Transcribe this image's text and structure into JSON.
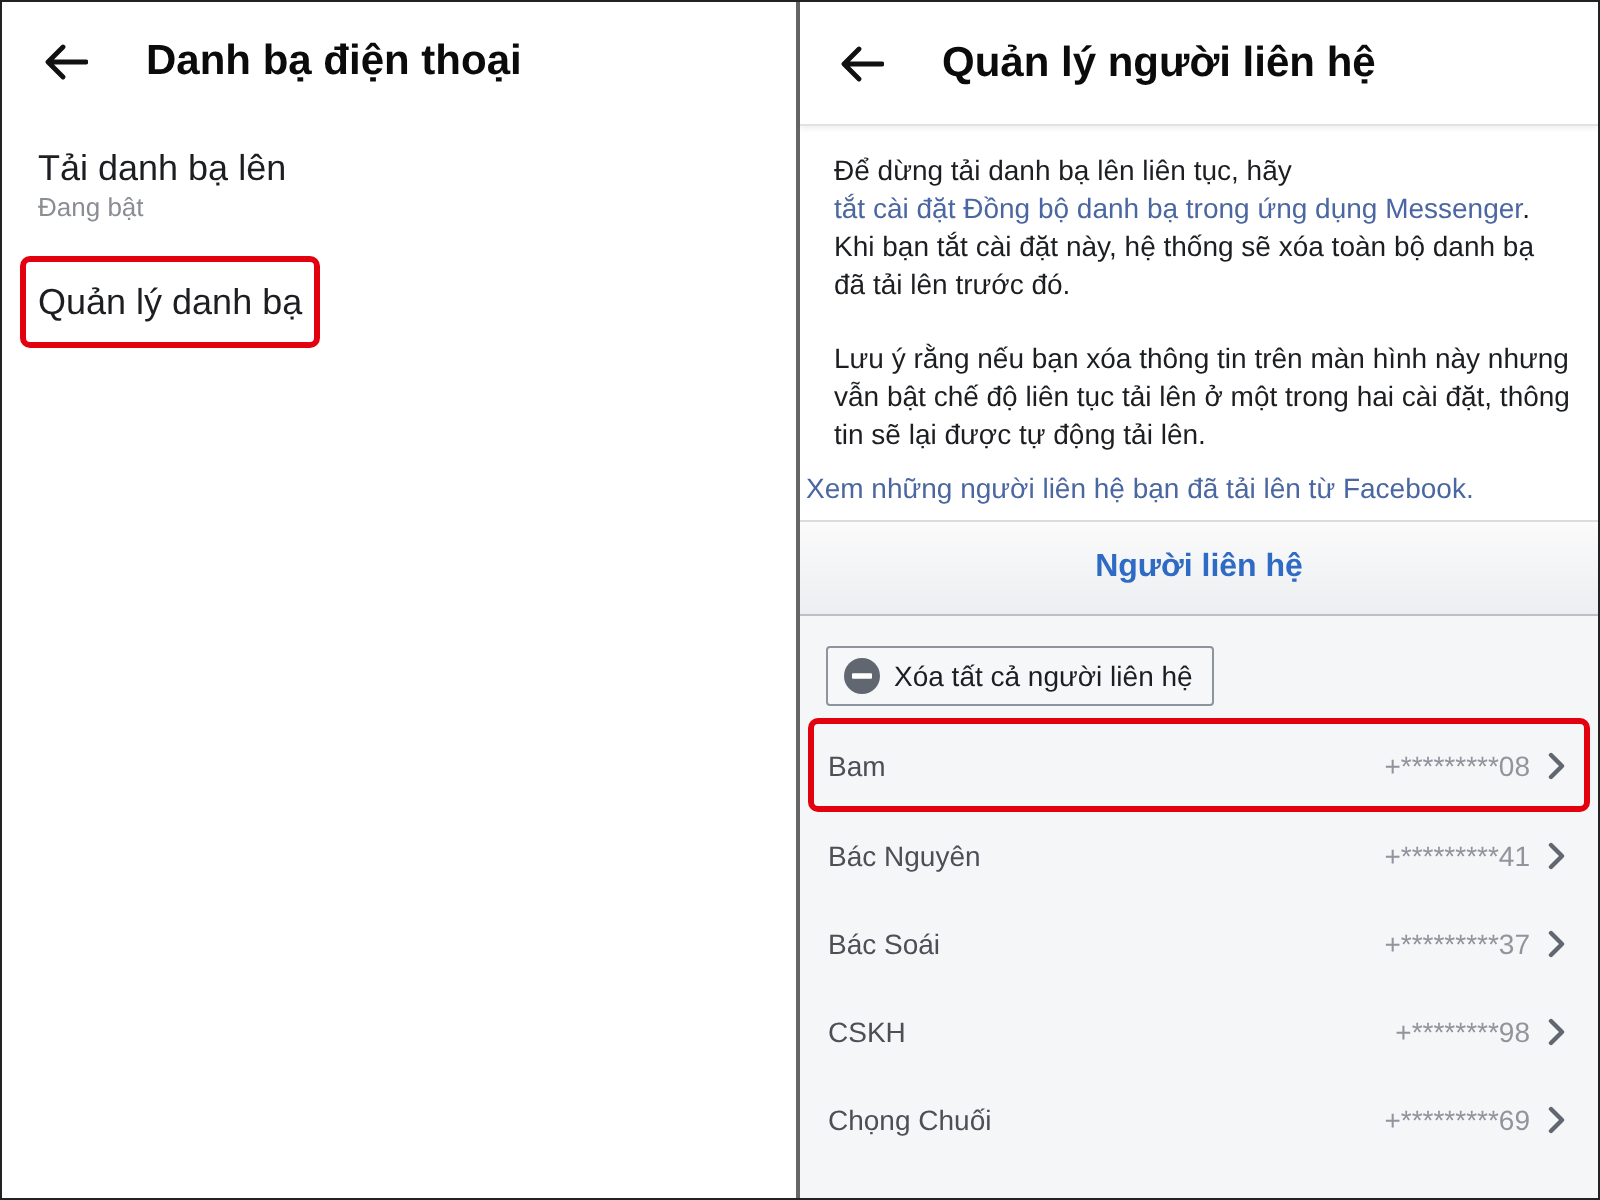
{
  "left_screen": {
    "title": "Danh bạ điện thoại",
    "items": [
      {
        "label": "Tải danh bạ lên",
        "subtitle": "Đang bật",
        "highlighted": false
      },
      {
        "label": "Quản lý danh bạ",
        "highlighted": true
      }
    ]
  },
  "right_screen": {
    "title": "Quản lý người liên hệ",
    "paragraphs": [
      [
        {
          "kind": "text",
          "text": "Để dừng tải danh bạ lên liên tục, hãy "
        },
        {
          "kind": "link",
          "text": "tắt cài đặt Đồng bộ danh bạ trong ứng dụng Messenger"
        },
        {
          "kind": "text",
          "text": ". Khi bạn tắt cài đặt này, hệ thống sẽ xóa toàn bộ danh bạ đã tải lên trước đó."
        }
      ],
      [
        {
          "kind": "text",
          "text": "Lưu ý rằng nếu bạn xóa thông tin trên màn hình này nhưng vẫn bật chế độ liên tục tải lên ở một trong hai cài đặt, thông tin sẽ lại được tự động tải lên."
        }
      ]
    ],
    "uploaded_link": "Xem những người liên hệ bạn đã tải lên từ Facebook.",
    "section_title": "Người liên hệ",
    "delete_all_button": "Xóa tất cả người liên hệ",
    "contacts": [
      {
        "name": "Bam",
        "phone": "+*********08",
        "highlighted": true
      },
      {
        "name": "Bác Nguyên",
        "phone": "+*********41",
        "highlighted": false
      },
      {
        "name": "Bác Soái",
        "phone": "+*********37",
        "highlighted": false
      },
      {
        "name": "CSKH",
        "phone": "+********98",
        "highlighted": false
      },
      {
        "name": "Chọng Chuối",
        "phone": "+*********69",
        "highlighted": false
      }
    ]
  }
}
